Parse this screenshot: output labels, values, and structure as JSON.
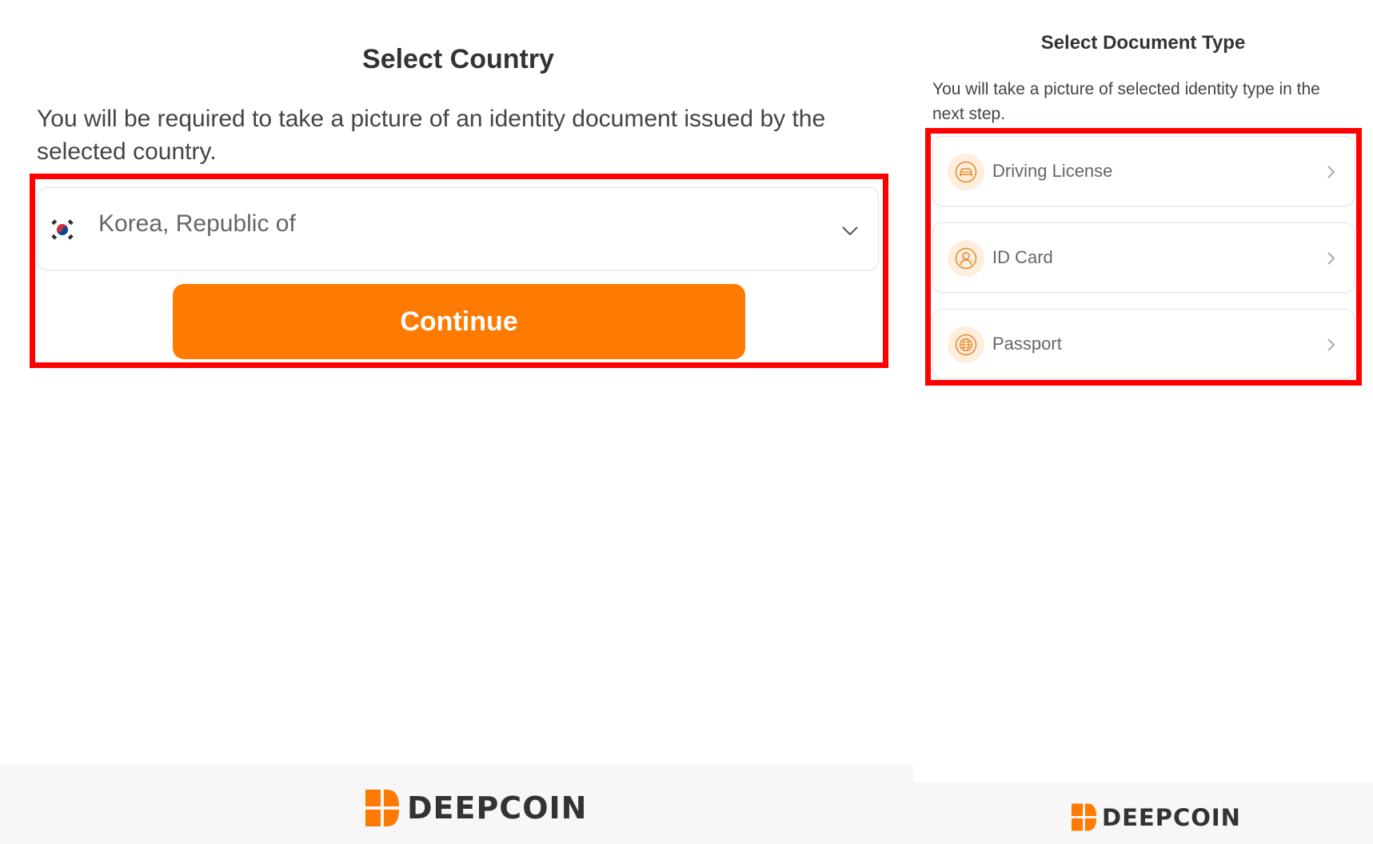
{
  "left_panel": {
    "title": "Select Country",
    "description": "You will be required to take a picture of an identity document issued by the selected country.",
    "country_select": {
      "value": "Korea, Republic of",
      "flag_icon": "south-korea-flag-icon",
      "dropdown_icon": "chevron-down-icon"
    },
    "continue_button": "Continue",
    "footer_brand": "DEEPCOIN"
  },
  "right_panel": {
    "title": "Select Document Type",
    "description": "You will take a picture of selected identity type in the next step.",
    "document_types": [
      {
        "label": "Driving License",
        "icon": "car-icon"
      },
      {
        "label": "ID Card",
        "icon": "user-icon"
      },
      {
        "label": "Passport",
        "icon": "globe-icon"
      }
    ],
    "footer_brand": "DEEPCOIN"
  },
  "colors": {
    "accent": "#ff7a00",
    "highlight_border": "#ff0000",
    "icon_bg": "#fdeede",
    "icon_stroke": "#e8892b"
  }
}
